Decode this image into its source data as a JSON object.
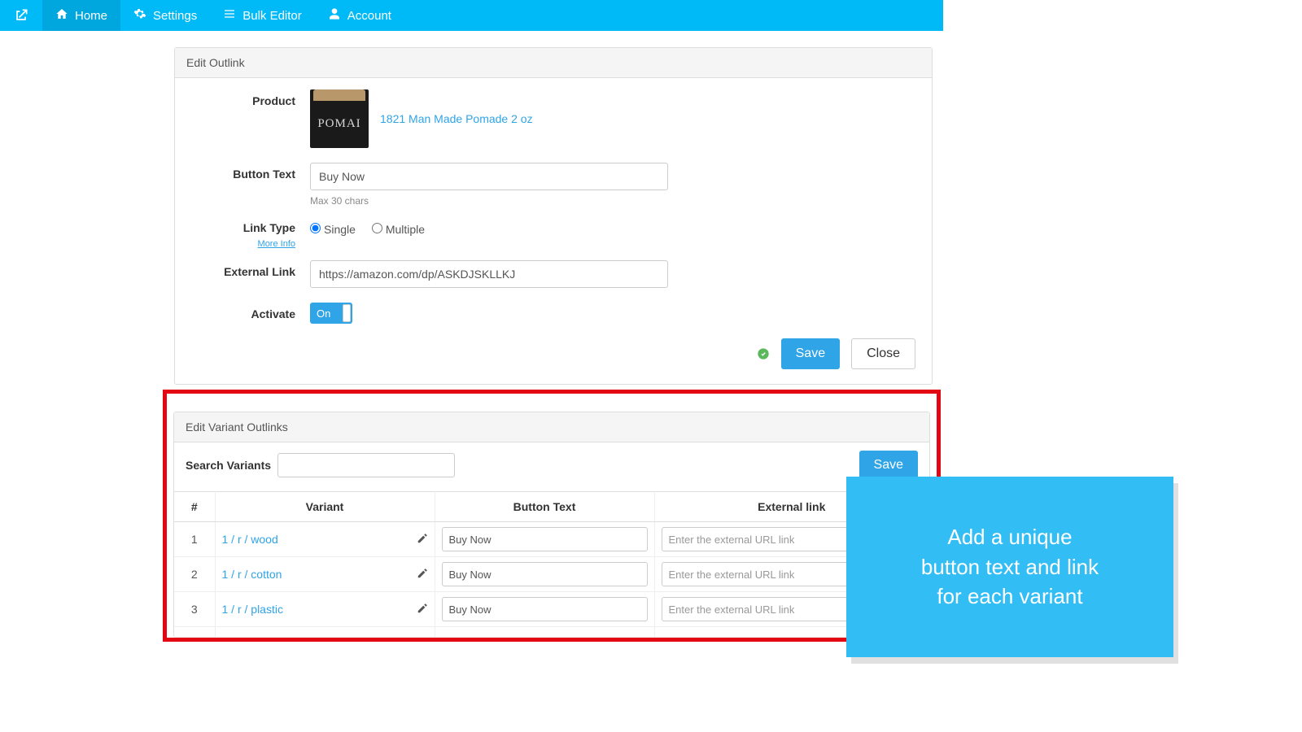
{
  "nav": {
    "home": "Home",
    "settings": "Settings",
    "bulk_editor": "Bulk Editor",
    "account": "Account"
  },
  "panel1": {
    "title": "Edit Outlink",
    "labels": {
      "product": "Product",
      "button_text": "Button Text",
      "link_type": "Link Type",
      "external_link": "External Link",
      "activate": "Activate"
    },
    "product_name": "1821 Man Made Pomade 2 oz",
    "button_text_value": "Buy Now",
    "button_text_hint": "Max 30 chars",
    "link_type": {
      "single": "Single",
      "multiple": "Multiple",
      "more_info": "More Info"
    },
    "external_link_value": "https://amazon.com/dp/ASKDJSKLLKJ",
    "activate_state": "On",
    "actions": {
      "save": "Save",
      "close": "Close"
    }
  },
  "panel2": {
    "title": "Edit Variant Outlinks",
    "search_label": "Search Variants",
    "save": "Save",
    "columns": {
      "num": "#",
      "variant": "Variant",
      "button_text": "Button Text",
      "external_link": "External link"
    },
    "ext_placeholder": "Enter the external URL link",
    "rows": [
      {
        "n": "1",
        "variant": "1 / r / wood",
        "button_text": "Buy Now"
      },
      {
        "n": "2",
        "variant": "1 / r / cotton",
        "button_text": "Buy Now"
      },
      {
        "n": "3",
        "variant": "1 / r / plastic",
        "button_text": "Buy Now"
      }
    ]
  },
  "callout": {
    "line1": "Add a unique",
    "line2": "button text and link",
    "line3": "for each variant"
  }
}
